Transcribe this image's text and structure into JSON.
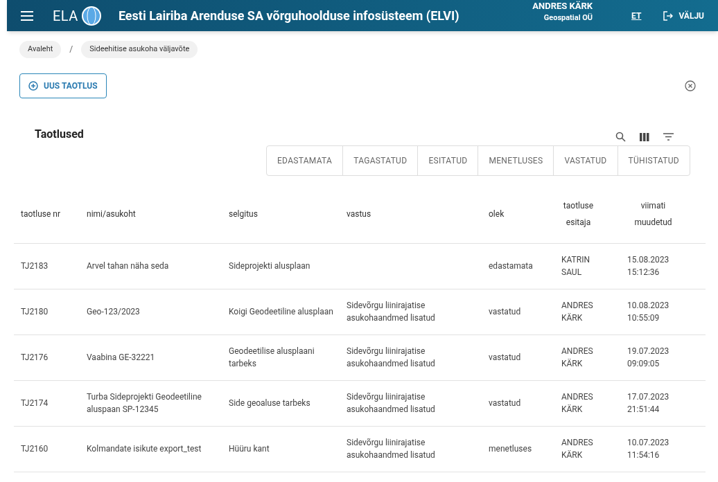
{
  "header": {
    "logo_text": "ELA",
    "title": "Eesti Lairiba Arenduse SA võrguhoolduse infosüsteem (ELVI)",
    "user_name": "ANDRES KÄRK",
    "user_org": "Geospatial OÜ",
    "language": "ET",
    "logout": "VÄLJU"
  },
  "breadcrumbs": [
    "Avaleht",
    "Sideehitise asukoha väljavõte"
  ],
  "breadcrumb_separator": "/",
  "new_button": "UUS TAOTLUS",
  "section_title": "Taotlused",
  "filter_tabs": [
    {
      "label": "EDASTAMATA",
      "selected": false
    },
    {
      "label": "TAGASTATUD",
      "selected": false
    },
    {
      "label": "ESITATUD",
      "selected": false
    },
    {
      "label": "MENETLUSES",
      "selected": false
    },
    {
      "label": "VASTATUD",
      "selected": false
    },
    {
      "label": "TÜHISTATUD",
      "selected": false
    }
  ],
  "table": {
    "columns": [
      "taotluse nr",
      "nimi/asukoht",
      "selgitus",
      "vastus",
      "olek",
      "taotluse esitaja",
      "viimati muudetud"
    ],
    "rows": [
      [
        "TJ2183",
        "Arvel tahan näha seda",
        "Sideprojekti alusplaan",
        "",
        "edastamata",
        "KATRIN SAUL",
        "15.08.2023 15:12:36"
      ],
      [
        "TJ2180",
        "Geo-123/2023",
        "Koigi Geodeetiline alusplaan",
        "Sidevõrgu liinirajatise asukohaandmed lisatud",
        "vastatud",
        "ANDRES KÄRK",
        "10.08.2023 10:55:09"
      ],
      [
        "TJ2176",
        "Vaabina GE-32221",
        "Geodeetilise alusplaani tarbeks",
        "Sidevõrgu liinirajatise asukohaandmed lisatud",
        "vastatud",
        "ANDRES KÄRK",
        "19.07.2023 09:09:05"
      ],
      [
        "TJ2174",
        "Turba Sideprojekti Geodeetiline aluspaan SP-12345",
        "Side geoaluse tarbeks",
        "Sidevõrgu liinirajatise asukohaandmed lisatud",
        "vastatud",
        "ANDRES KÄRK",
        "17.07.2023 21:51:44"
      ],
      [
        "TJ2160",
        "Kolmandate isikute export_test",
        "Hüüru kant",
        "Sidevõrgu liinirajatise asukohaandmed lisatud",
        "menetluses",
        "ANDRES KÄRK",
        "10.07.2023 11:54:16"
      ]
    ]
  }
}
